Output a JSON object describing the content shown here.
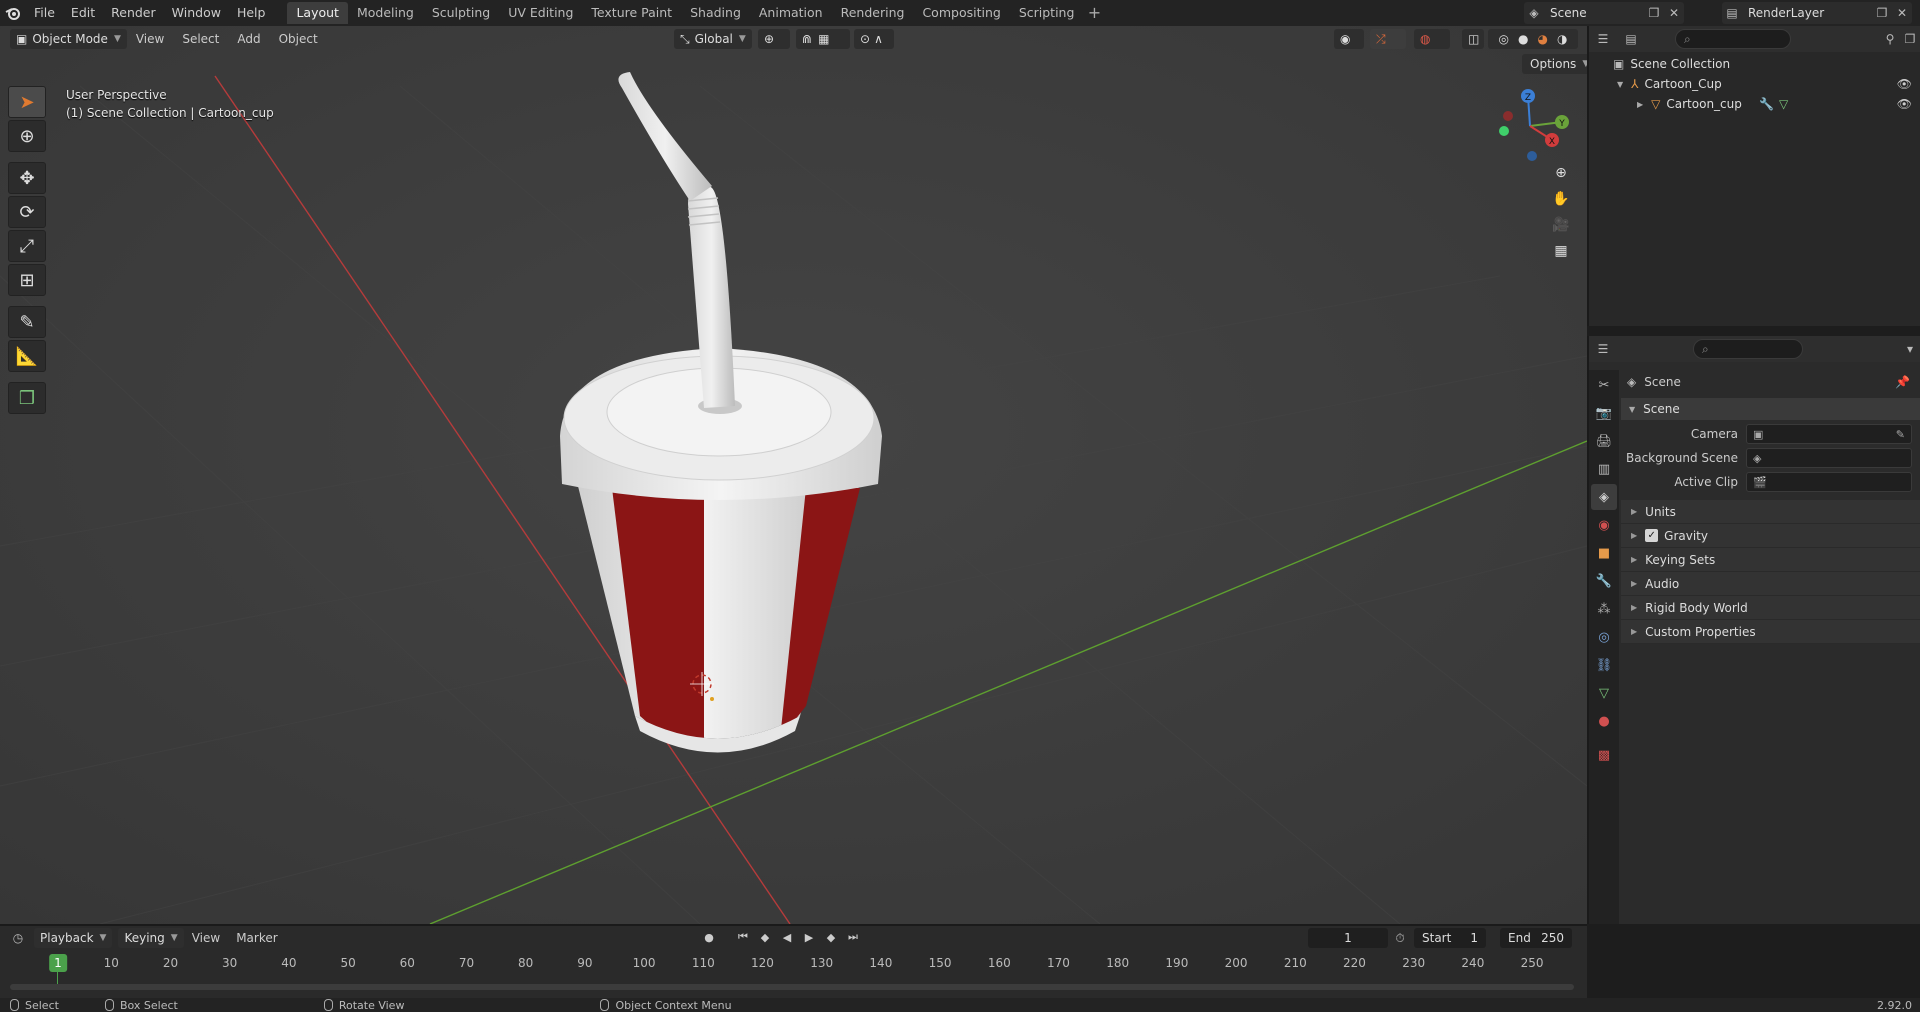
{
  "topbar": {
    "menus": [
      "File",
      "Edit",
      "Render",
      "Window",
      "Help"
    ],
    "workspaces": [
      "Layout",
      "Modeling",
      "Sculpting",
      "UV Editing",
      "Texture Paint",
      "Shading",
      "Animation",
      "Rendering",
      "Compositing",
      "Scripting"
    ],
    "active_workspace": "Layout",
    "scene_name": "Scene",
    "view_layer": "RenderLayer"
  },
  "viewport": {
    "mode": "Object Mode",
    "menus": [
      "View",
      "Select",
      "Add",
      "Object"
    ],
    "transform_orientation": "Global",
    "options_label": "Options",
    "info_line1": "User Perspective",
    "info_line2": "(1) Scene Collection | Cartoon_cup",
    "gizmo_axes": [
      "X",
      "Y",
      "Z"
    ]
  },
  "outliner": {
    "search_placeholder": "",
    "items": [
      {
        "label": "Scene Collection",
        "level": 0
      },
      {
        "label": "Cartoon_Cup",
        "level": 1
      },
      {
        "label": "Cartoon_cup",
        "level": 2
      }
    ]
  },
  "properties": {
    "context": "Scene",
    "panel_title": "Scene",
    "fields": [
      {
        "label": "Camera",
        "value": ""
      },
      {
        "label": "Background Scene",
        "value": ""
      },
      {
        "label": "Active Clip",
        "value": ""
      }
    ],
    "subpanels": [
      "Units",
      "Gravity",
      "Keying Sets",
      "Audio",
      "Rigid Body World",
      "Custom Properties"
    ],
    "gravity_checked": true
  },
  "timeline": {
    "menus": [
      "Playback",
      "Keying",
      "View",
      "Marker"
    ],
    "current_frame": "1",
    "start_label": "Start",
    "start": "1",
    "end_label": "End",
    "end": "250",
    "ticks": [
      "10",
      "20",
      "30",
      "40",
      "50",
      "60",
      "70",
      "80",
      "90",
      "100",
      "110",
      "120",
      "130",
      "140",
      "150",
      "160",
      "170",
      "180",
      "190",
      "200",
      "210",
      "220",
      "230",
      "240",
      "250"
    ]
  },
  "statusbar": {
    "select": "Select",
    "box_select": "Box Select",
    "rotate_view": "Rotate View",
    "context_menu": "Object Context Menu",
    "version": "2.92.0"
  },
  "colors": {
    "accent": "#4772b3",
    "cup_red": "#8b1515",
    "cup_white": "#e9e9e9",
    "x_axis": "#b53b3b",
    "y_axis": "#5ea02f",
    "current_frame": "#4ba14b"
  }
}
